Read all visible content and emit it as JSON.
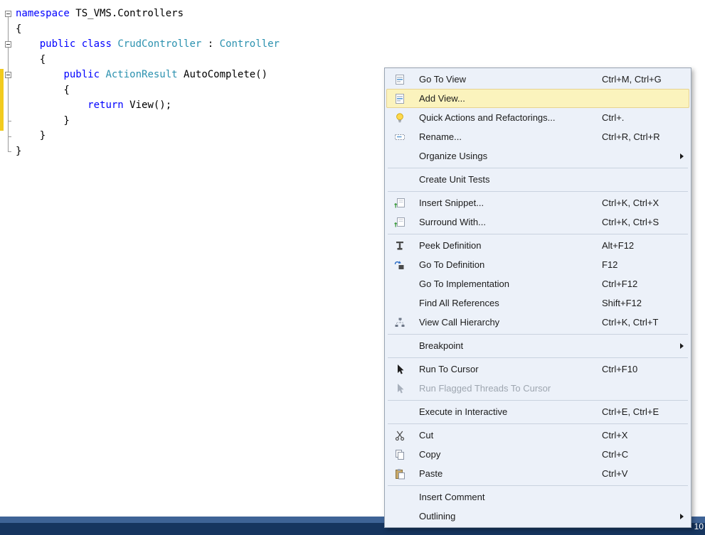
{
  "editor": {
    "code_lines": [
      [
        {
          "t": "namespace",
          "c": "kw"
        },
        {
          "t": " TS_VMS.Controllers",
          "c": "pl"
        }
      ],
      [
        {
          "t": "{",
          "c": "pl"
        }
      ],
      [
        {
          "t": "    ",
          "c": "pl"
        },
        {
          "t": "public",
          "c": "kw"
        },
        {
          "t": " ",
          "c": "pl"
        },
        {
          "t": "class",
          "c": "kw"
        },
        {
          "t": " ",
          "c": "pl"
        },
        {
          "t": "CrudController",
          "c": "ty"
        },
        {
          "t": " : ",
          "c": "pl"
        },
        {
          "t": "Controller",
          "c": "ty"
        }
      ],
      [
        {
          "t": "    {",
          "c": "pl"
        }
      ],
      [
        {
          "t": "        ",
          "c": "pl"
        },
        {
          "t": "public",
          "c": "kw"
        },
        {
          "t": " ",
          "c": "pl"
        },
        {
          "t": "ActionResult",
          "c": "ty"
        },
        {
          "t": " AutoComplete()",
          "c": "pl"
        }
      ],
      [
        {
          "t": "        {",
          "c": "pl"
        }
      ],
      [
        {
          "t": "            ",
          "c": "pl"
        },
        {
          "t": "return",
          "c": "kw"
        },
        {
          "t": " View();",
          "c": "pl"
        }
      ],
      [
        {
          "t": "        }",
          "c": "pl"
        }
      ],
      [
        {
          "t": "    }",
          "c": "pl"
        }
      ],
      [
        {
          "t": "}",
          "c": "pl"
        }
      ]
    ]
  },
  "context_menu": {
    "groups": [
      {
        "items": [
          {
            "label": "Go To View",
            "shortcut": "Ctrl+M, Ctrl+G",
            "icon": "goto-view-icon"
          },
          {
            "label": "Add View...",
            "shortcut": "",
            "icon": "add-view-icon",
            "highlighted": true
          },
          {
            "label": "Quick Actions and Refactorings...",
            "shortcut": "Ctrl+.",
            "icon": "lightbulb-icon"
          },
          {
            "label": "Rename...",
            "shortcut": "Ctrl+R, Ctrl+R",
            "icon": "rename-icon"
          },
          {
            "label": "Organize Usings",
            "submenu": true
          }
        ]
      },
      {
        "items": [
          {
            "label": "Create Unit Tests"
          }
        ]
      },
      {
        "items": [
          {
            "label": "Insert Snippet...",
            "shortcut": "Ctrl+K, Ctrl+X",
            "icon": "insert-snippet-icon"
          },
          {
            "label": "Surround With...",
            "shortcut": "Ctrl+K, Ctrl+S",
            "icon": "surround-with-icon"
          }
        ]
      },
      {
        "items": [
          {
            "label": "Peek Definition",
            "shortcut": "Alt+F12",
            "icon": "peek-definition-icon"
          },
          {
            "label": "Go To Definition",
            "shortcut": "F12",
            "icon": "goto-definition-icon"
          },
          {
            "label": "Go To Implementation",
            "shortcut": "Ctrl+F12"
          },
          {
            "label": "Find All References",
            "shortcut": "Shift+F12"
          },
          {
            "label": "View Call Hierarchy",
            "shortcut": "Ctrl+K, Ctrl+T",
            "icon": "call-hierarchy-icon"
          }
        ]
      },
      {
        "items": [
          {
            "label": "Breakpoint",
            "submenu": true
          }
        ]
      },
      {
        "items": [
          {
            "label": "Run To Cursor",
            "shortcut": "Ctrl+F10",
            "icon": "run-to-cursor-icon"
          },
          {
            "label": "Run Flagged Threads To Cursor",
            "disabled": true,
            "icon": "run-flagged-icon"
          }
        ]
      },
      {
        "items": [
          {
            "label": "Execute in Interactive",
            "shortcut": "Ctrl+E, Ctrl+E"
          }
        ]
      },
      {
        "items": [
          {
            "label": "Cut",
            "shortcut": "Ctrl+X",
            "icon": "cut-icon"
          },
          {
            "label": "Copy",
            "shortcut": "Ctrl+C",
            "icon": "copy-icon"
          },
          {
            "label": "Paste",
            "shortcut": "Ctrl+V",
            "icon": "paste-icon"
          }
        ]
      },
      {
        "items": [
          {
            "label": "Insert Comment"
          },
          {
            "label": "Outlining",
            "submenu": true
          }
        ]
      }
    ]
  },
  "status_bar": {
    "right_text": "10"
  },
  "colors": {
    "keyword": "#0000FF",
    "type": "#2B91AF",
    "menu_highlight": "#FBF3BD",
    "change_bar": "#F2CB1D"
  }
}
